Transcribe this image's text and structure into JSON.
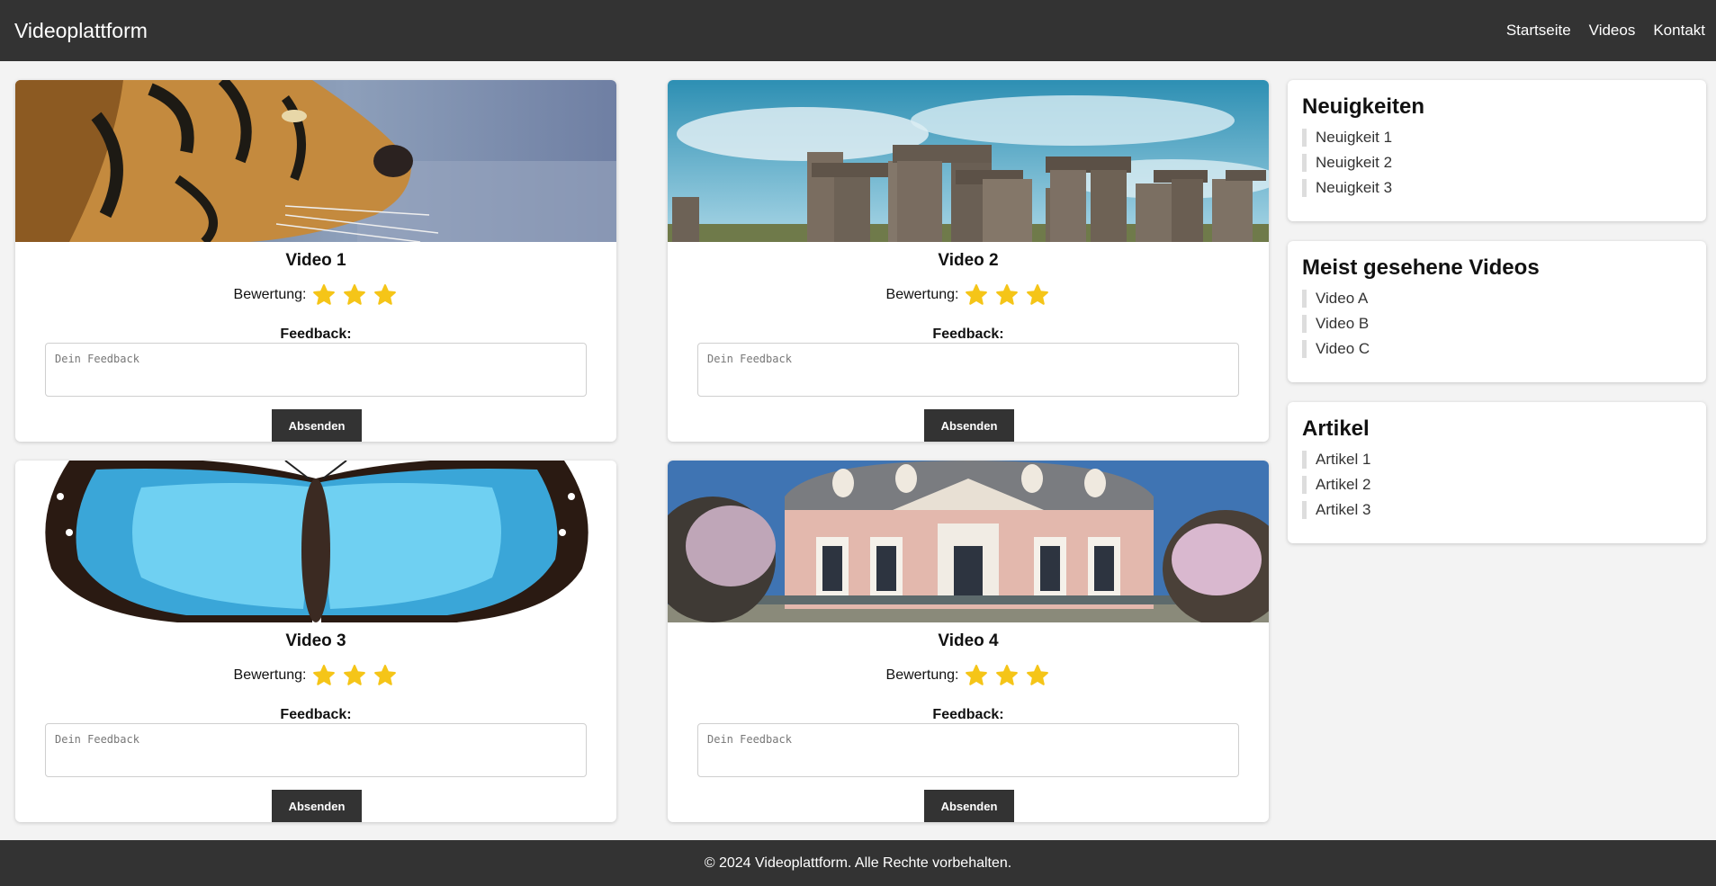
{
  "header": {
    "brand": "Videoplattform",
    "nav": [
      "Startseite",
      "Videos",
      "Kontakt"
    ]
  },
  "videos": [
    {
      "title": "Video 1",
      "rating_label": "Bewertung:",
      "stars": 3,
      "feedback_label": "Feedback:",
      "placeholder": "Dein Feedback",
      "submit": "Absenden",
      "thumbnail": "tiger"
    },
    {
      "title": "Video 2",
      "rating_label": "Bewertung:",
      "stars": 3,
      "feedback_label": "Feedback:",
      "placeholder": "Dein Feedback",
      "submit": "Absenden",
      "thumbnail": "stonehenge"
    },
    {
      "title": "Video 3",
      "rating_label": "Bewertung:",
      "stars": 3,
      "feedback_label": "Feedback:",
      "placeholder": "Dein Feedback",
      "submit": "Absenden",
      "thumbnail": "butterfly"
    },
    {
      "title": "Video 4",
      "rating_label": "Bewertung:",
      "stars": 3,
      "feedback_label": "Feedback:",
      "placeholder": "Dein Feedback",
      "submit": "Absenden",
      "thumbnail": "palace"
    }
  ],
  "sidebar": {
    "news": {
      "title": "Neuigkeiten",
      "items": [
        "Neuigkeit 1",
        "Neuigkeit 2",
        "Neuigkeit 3"
      ]
    },
    "popular": {
      "title": "Meist gesehene Videos",
      "items": [
        "Video A",
        "Video B",
        "Video C"
      ]
    },
    "articles": {
      "title": "Artikel",
      "items": [
        "Artikel 1",
        "Artikel 2",
        "Artikel 3"
      ]
    }
  },
  "footer": {
    "text": "© 2024 Videoplattform. Alle Rechte vorbehalten."
  },
  "colors": {
    "header_bg": "#333333",
    "star": "#f5c518",
    "page_bg": "#f3f3f3"
  }
}
